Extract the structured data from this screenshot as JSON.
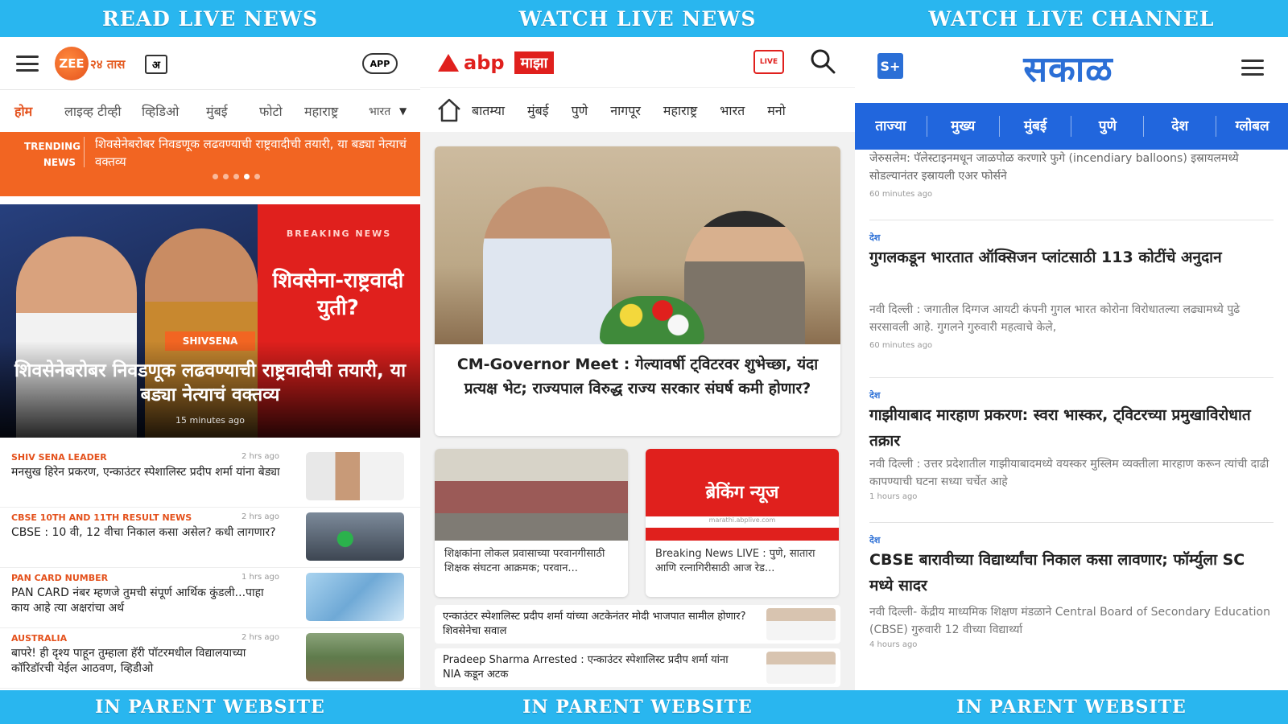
{
  "panel1": {
    "banner_top": "READ LIVE NEWS",
    "banner_bottom": "IN PARENT WEBSITE",
    "logo_text": "ZEE",
    "logo_sub": "२४ तास",
    "lang_icon_text": "अ",
    "app_badge": "APP",
    "nav": [
      "होम",
      "लाइव्ह टीव्ही",
      "व्हिडिओ",
      "मुंबई",
      "फोटो",
      "महाराष्ट्र",
      "भारत"
    ],
    "ticker": {
      "label_line1": "TRENDING",
      "label_line2": "NEWS",
      "text": "शिवसेनेबरोबर निवडणूक लढवण्याची राष्ट्रवादीची तयारी, या बड्या नेत्याचं वक्तव्य"
    },
    "hero": {
      "breaking_label": "BREAKING NEWS",
      "breaking_title": "शिवसेना-राष्ट्रवादी युती?",
      "tag": "SHIVSENA",
      "caption": "शिवसेनेबरोबर निवडणूक लढवण्याची राष्ट्रवादीची तयारी, या बड्या नेत्याचं वक्तव्य",
      "time": "15 minutes ago"
    },
    "items": [
      {
        "category": "SHIV SENA LEADER",
        "ago": "2 hrs ago",
        "title": "मनसुख हिरेन प्रकरण, एन्काउंटर स्पेशालिस्ट प्रदीप शर्मा यांना बेड्या"
      },
      {
        "category": "CBSE 10TH AND 11TH RESULT NEWS",
        "ago": "2 hrs ago",
        "title": "CBSE : 10 वी, 12 वीचा निकाल कसा असेल? कधी लागणार?"
      },
      {
        "category": "PAN CARD NUMBER",
        "ago": "1 hrs ago",
        "title": "PAN CARD नंबर म्हणजे तुमची संपूर्ण आर्थिक कुंडली...पाहा काय आहे त्या अक्षरांचा अर्थ"
      },
      {
        "category": "AUSTRALIA",
        "ago": "2 hrs ago",
        "title": "बापरे! ही दृश्य पाहून तुम्हाला हॅरी पॉटरमधील विद्यालयाच्या कॉरिडॉरची येईल आठवण, व्हिडीओ"
      }
    ]
  },
  "panel2": {
    "banner_top": "WATCH LIVE NEWS",
    "banner_bottom": "IN PARENT WEBSITE",
    "logo_word": "abp",
    "logo_sub": "माझा",
    "live_label": "LIVE",
    "nav": [
      "बातम्या",
      "मुंबई",
      "पुणे",
      "नागपूर",
      "महाराष्ट्र",
      "भारत",
      "मनो"
    ],
    "hero_title": "CM-Governor Meet : गेल्यावर्षी ट्विटरवर शुभेच्छा, यंदा प्रत्यक्ष भेट; राज्यपाल विरुद्ध राज्य सरकार संघर्ष कमी होणार?",
    "card1_title": "शिक्षकांना लोकल प्रवासाच्या परवानगीसाठी शिक्षक संघटना आक्रमक; परवान...",
    "card2_badge": "ब्रेकिंग न्यूज",
    "card2_url": "marathi.abplive.com",
    "card2_title": "Breaking News LIVE : पुणे, सातारा आणि रत्नागिरीसाठी आज रेड...",
    "row1_title": "एन्काउंटर स्पेशालिस्ट प्रदीप शर्मा यांच्या अटकेनंतर मोदी भाजपात सामील होणार? शिवसेनेचा सवाल",
    "row2_title": "Pradeep Sharma Arrested : एन्काउंटर स्पेशालिस्ट प्रदीप शर्मा यांना NIA कडून अटक"
  },
  "panel3": {
    "banner_top": "WATCH LIVE CHANNEL",
    "banner_bottom": "IN PARENT WEBSITE",
    "icon_text": "S+",
    "logo": "सकाळ",
    "nav": [
      "ताज्या",
      "मुख्य",
      "मुंबई",
      "पुणे",
      "देश",
      "ग्लोबल"
    ],
    "top_summary": "जेरुसलेम: पॅलेस्टाइनमधून जाळपोळ करणारे फुगे (incendiary balloons) इस्रायलमध्ये सोडल्यानंतर इस्रायली एअर फोर्सने",
    "top_ago": "60 minutes ago",
    "items": [
      {
        "category": "देश",
        "title": "गुगलकडून भारतात ऑक्सिजन प्लांटसाठी 113 कोटींचे अनुदान",
        "summary": "नवी दिल्ली : जगातील दिग्गज आयटी कंपनी गुगल भारत कोरोना विरोधातल्या लढ्यामध्ये पुढे सरसावली आहे. गुगलने गुरुवारी महत्वाचे केले,",
        "ago": "60 minutes ago"
      },
      {
        "category": "देश",
        "title": "गाझीयाबाद मारहाण प्रकरण: स्वरा भास्कर, ट्विटरच्या प्रमुखाविरोधात तक्रार",
        "summary": "नवी दिल्ली : उत्तर प्रदेशातील गाझीयाबादमध्ये वयस्कर मुस्लिम व्यक्तीला मारहाण करून त्यांची दाढी कापण्याची घटना सध्या चर्चेत आहे",
        "ago": "1 hours ago"
      },
      {
        "category": "देश",
        "title": "CBSE बारावीच्या विद्यार्थ्यांचा निकाल कसा लावणार; फॉर्म्युला SC मध्ये सादर",
        "summary": "नवी दिल्ली- केंद्रीय माध्यमिक शिक्षण मंडळाने Central Board of Secondary Education (CBSE) गुरुवारी 12 वीच्या विद्यार्थ्या",
        "ago": "4 hours ago"
      }
    ]
  },
  "colors": {
    "banner": "#29b6ef",
    "zee_orange": "#f26522",
    "abp_red": "#e0201d",
    "sakal_blue": "#2166dd"
  }
}
